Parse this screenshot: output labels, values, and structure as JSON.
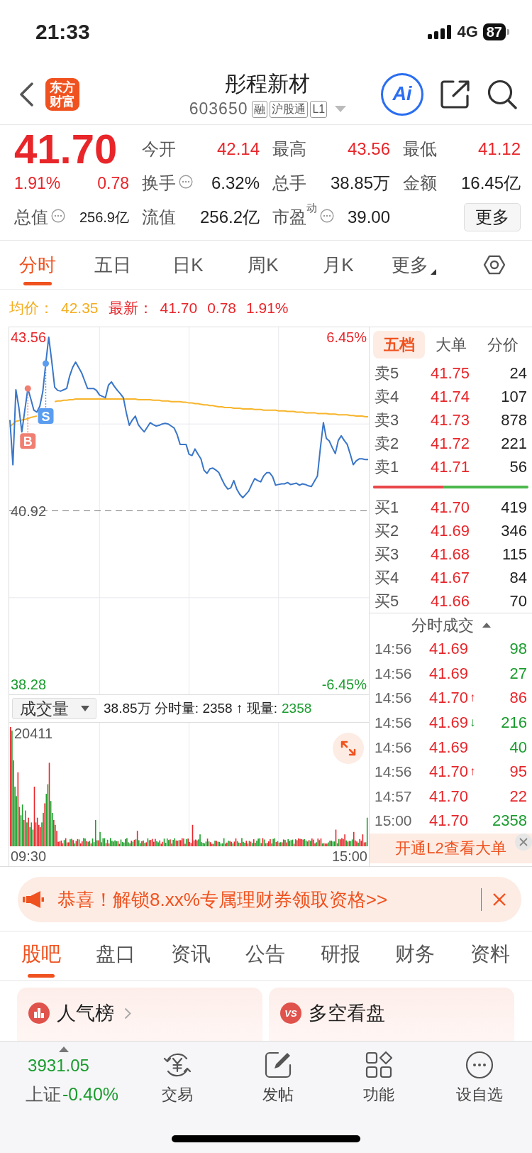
{
  "status_bar": {
    "time": "21:33",
    "network": "4G",
    "battery": "87"
  },
  "header": {
    "logo": "东方财富",
    "title": "彤程新材",
    "code": "603650",
    "tags": [
      "融",
      "沪股通",
      "L1"
    ],
    "ai_label": "Ai"
  },
  "quote": {
    "price": "41.70",
    "rising": true,
    "change_pct": "1.91%",
    "change": "0.78",
    "total_value": {
      "label": "总值",
      "value": "256.9亿",
      "info": true
    },
    "stats": [
      {
        "label": "今开",
        "value": "42.14",
        "color": "#e8262a",
        "info": false
      },
      {
        "label": "最高",
        "value": "43.56",
        "color": "#e8262a",
        "info": false
      },
      {
        "label": "最低",
        "value": "41.12",
        "color": "#e8262a",
        "info": false
      },
      {
        "label": "换手",
        "value": "6.32%",
        "color": "#222222",
        "info": true
      },
      {
        "label": "总手",
        "value": "38.85万",
        "color": "#222222",
        "info": false
      },
      {
        "label": "金额",
        "value": "16.45亿",
        "color": "#222222",
        "info": false
      },
      {
        "label": "流值",
        "value": "256.2亿",
        "color": "#222222",
        "info": false
      },
      {
        "label": "市盈$^{动}$",
        "value": "39.00",
        "color": "#222222",
        "info": true
      }
    ],
    "more_button": "更多"
  },
  "chart_tabs": [
    {
      "label": "分时",
      "selected": true,
      "dropdown": false
    },
    {
      "label": "五日",
      "selected": false,
      "dropdown": false
    },
    {
      "label": "日K",
      "selected": false,
      "dropdown": false
    },
    {
      "label": "周K",
      "selected": false,
      "dropdown": false
    },
    {
      "label": "月K",
      "selected": false,
      "dropdown": false
    },
    {
      "label": "更多",
      "selected": false,
      "dropdown": true
    }
  ],
  "price_chart": {
    "legend": [
      {
        "label": "均价：",
        "values": [
          "42.35"
        ],
        "color": "#f5ad1f"
      },
      {
        "label": "最新：",
        "values": [
          "41.70",
          "0.78",
          "1.91%"
        ],
        "color": "#e8262a"
      }
    ],
    "right_labels": [
      "6.45%",
      "-6.45%"
    ],
    "chart_data": {
      "type": "line",
      "categories": [
        null,
        null,
        null,
        null,
        null,
        null,
        null,
        null,
        null,
        null,
        null,
        null,
        null,
        null,
        null,
        null,
        null,
        null,
        null,
        null,
        null,
        null,
        null,
        null,
        null,
        null,
        null,
        null,
        null,
        null,
        null,
        null,
        null,
        null,
        null,
        null,
        null,
        null,
        null,
        null,
        null,
        null,
        null,
        null,
        null,
        null,
        null,
        null,
        null,
        null,
        null,
        null,
        null,
        null,
        null,
        null,
        null,
        null,
        null,
        null,
        null,
        null,
        null,
        null,
        null,
        null,
        null,
        null,
        null,
        null,
        null,
        null,
        null,
        null,
        null,
        null,
        null,
        null,
        null,
        null,
        null,
        null,
        null,
        null,
        null,
        null,
        null,
        null,
        null,
        null,
        null,
        null,
        null,
        null,
        null,
        null,
        null,
        null,
        null,
        null,
        null,
        null,
        null,
        null,
        null,
        null,
        null,
        null,
        null,
        null,
        null,
        null,
        null,
        null,
        null,
        null,
        null,
        null,
        null,
        null,
        null
      ],
      "series": [
        {
          "color": "#f7b52c",
          "values": [
            42.2,
            42.24,
            42.28,
            42.29,
            42.3,
            42.31,
            42.32,
            42.34,
            42.35,
            42.36,
            null,
            null,
            null,
            null,
            null,
            42.58,
            42.59,
            42.59,
            42.6,
            42.6,
            42.61,
            42.61,
            42.62,
            42.62,
            42.62,
            42.62,
            42.62,
            42.62,
            42.62,
            42.62,
            42.62,
            42.62,
            42.62,
            42.62,
            42.62,
            42.62,
            42.62,
            42.62,
            42.62,
            42.62,
            42.62,
            42.62,
            42.62,
            42.61,
            42.61,
            42.61,
            42.61,
            42.61,
            42.6,
            42.6,
            42.6,
            42.59,
            42.59,
            42.59,
            42.58,
            42.58,
            42.58,
            42.58,
            42.57,
            42.57,
            42.56,
            42.56,
            42.55,
            42.55,
            42.54,
            42.53,
            42.53,
            42.52,
            42.52,
            42.51,
            42.5,
            42.5,
            42.49,
            42.49,
            42.49,
            42.48,
            42.48,
            42.48,
            42.47,
            42.47,
            42.47,
            42.47,
            42.46,
            42.46,
            42.46,
            42.45,
            42.45,
            42.45,
            42.45,
            42.45,
            42.44,
            42.44,
            42.44,
            42.43,
            42.43,
            42.43,
            42.42,
            42.42,
            42.42,
            42.41,
            42.41,
            42.41,
            42.41,
            42.4,
            42.4,
            42.4,
            42.4,
            42.39,
            42.39,
            42.39,
            42.38,
            42.38,
            42.38,
            42.38,
            42.37,
            42.37,
            42.36,
            42.36,
            42.36,
            42.35,
            42.35
          ]
        },
        {
          "color": "#3a76c8",
          "values": [
            42.3,
            41.62,
            42.76,
            42.49,
            42.12,
            42.45,
            42.78,
            42.62,
            42.45,
            42.42,
            42.51,
            42.73,
            43.16,
            43.56,
            43.2,
            42.8,
            42.75,
            42.74,
            42.76,
            42.78,
            42.97,
            43.1,
            43.18,
            43.1,
            43.02,
            42.9,
            42.78,
            42.78,
            42.78,
            42.75,
            42.68,
            42.66,
            42.64,
            42.83,
            42.88,
            42.81,
            42.75,
            42.7,
            42.64,
            42.41,
            42.22,
            42.3,
            42.36,
            42.23,
            42.17,
            42.12,
            42.19,
            42.26,
            42.23,
            42.21,
            42.22,
            42.24,
            42.25,
            42.24,
            42.21,
            42.18,
            42.08,
            41.93,
            41.93,
            41.93,
            41.78,
            41.76,
            41.86,
            41.78,
            41.71,
            41.54,
            41.49,
            41.56,
            41.57,
            41.54,
            41.5,
            41.4,
            41.31,
            41.25,
            41.27,
            41.38,
            41.25,
            41.17,
            41.12,
            41.17,
            41.22,
            41.32,
            41.41,
            41.38,
            41.36,
            41.45,
            41.5,
            41.5,
            41.44,
            41.31,
            41.32,
            41.33,
            41.33,
            41.35,
            41.32,
            41.33,
            41.34,
            41.31,
            41.33,
            41.32,
            41.3,
            41.29,
            41.37,
            41.45,
            41.88,
            42.26,
            42.02,
            41.98,
            41.88,
            41.79,
            41.99,
            42.06,
            41.99,
            41.93,
            41.78,
            41.62,
            41.68,
            41.71,
            41.71,
            41.7,
            41.7
          ]
        }
      ],
      "ylim": [
        38.13,
        43.71
      ],
      "yticks": [
        {
          "value": 43.56,
          "label": "43.56"
        },
        {
          "value": 40.92,
          "label": "40.92"
        },
        {
          "value": 38.28,
          "label": "38.28"
        }
      ],
      "grid": true,
      "ref_lines": [
        {
          "axis": "y",
          "value": 40.92
        }
      ],
      "annotations": [
        {
          "y": 42.78,
          "text": "B"
        },
        {
          "y": 43.16,
          "text": "S"
        }
      ]
    }
  },
  "volume_panel": {
    "selector": "成交量",
    "summary": "38.85万 分时量: 2358 ↑ 现量:",
    "current_volume": "2358",
    "current_rising": false,
    "max_label": "20411"
  },
  "time_axis": [
    "09:30",
    "15:00"
  ],
  "order_book": {
    "tabs": [
      {
        "label": "五档",
        "selected": true
      },
      {
        "label": "大单",
        "selected": false
      },
      {
        "label": "分价",
        "selected": false
      }
    ],
    "asks": [
      {
        "label": "卖5",
        "price": "41.75",
        "volume": "24"
      },
      {
        "label": "卖4",
        "price": "41.74",
        "volume": "107"
      },
      {
        "label": "卖3",
        "price": "41.73",
        "volume": "878"
      },
      {
        "label": "卖2",
        "price": "41.72",
        "volume": "221"
      },
      {
        "label": "卖1",
        "price": "41.71",
        "volume": "56"
      }
    ],
    "level": 0.45,
    "bids": [
      {
        "label": "买1",
        "price": "41.70",
        "volume": "419"
      },
      {
        "label": "买2",
        "price": "41.69",
        "volume": "346"
      },
      {
        "label": "买3",
        "price": "41.68",
        "volume": "115"
      },
      {
        "label": "买4",
        "price": "41.67",
        "volume": "84"
      },
      {
        "label": "买5",
        "price": "41.66",
        "volume": "70"
      }
    ],
    "trades_title": "分时成交",
    "trades": [
      {
        "time": "14:56",
        "price": "41.69",
        "volume": "98",
        "buy": false
      },
      {
        "time": "14:56",
        "price": "41.69",
        "volume": "27",
        "buy": false
      },
      {
        "time": "14:56",
        "price": "41.70",
        "arrow": "↑",
        "uptick": true,
        "volume": "86",
        "buy": true
      },
      {
        "time": "14:56",
        "price": "41.69",
        "arrow": "↓",
        "uptick": false,
        "volume": "216",
        "buy": false
      },
      {
        "time": "14:56",
        "price": "41.69",
        "volume": "40",
        "buy": false
      },
      {
        "time": "14:56",
        "price": "41.70",
        "arrow": "↑",
        "uptick": true,
        "volume": "95",
        "buy": true
      },
      {
        "time": "14:57",
        "price": "41.70",
        "volume": "22",
        "buy": true
      },
      {
        "time": "15:00",
        "price": "41.70",
        "volume": "2358",
        "buy": false
      }
    ],
    "l2_promo": "开通L2查看大单"
  },
  "promo_banner": {
    "text": "恭喜！解锁8.xx%专属理财券领取资格>>"
  },
  "info_tabs": [
    {
      "label": "股吧",
      "selected": true
    },
    {
      "label": "盘口",
      "selected": false
    },
    {
      "label": "资讯",
      "selected": false
    },
    {
      "label": "公告",
      "selected": false
    },
    {
      "label": "研报",
      "selected": false
    },
    {
      "label": "财务",
      "selected": false
    },
    {
      "label": "资料",
      "selected": false
    }
  ],
  "cards": [
    {
      "kind": "ranking",
      "title": "人气榜",
      "chevron": true
    },
    {
      "kind": "versus",
      "icon_text": "VS",
      "title": "多空看盘",
      "chevron": false
    }
  ],
  "bottom_nav": {
    "index": {
      "value": "3931.05",
      "name": "上证",
      "change": "-0.40%",
      "rising": false
    },
    "items": [
      {
        "kind": "trade",
        "label": "交易"
      },
      {
        "kind": "post",
        "label": "发帖"
      },
      {
        "kind": "functions",
        "label": "功能"
      },
      {
        "kind": "watchlist",
        "label": "设自选"
      }
    ]
  }
}
